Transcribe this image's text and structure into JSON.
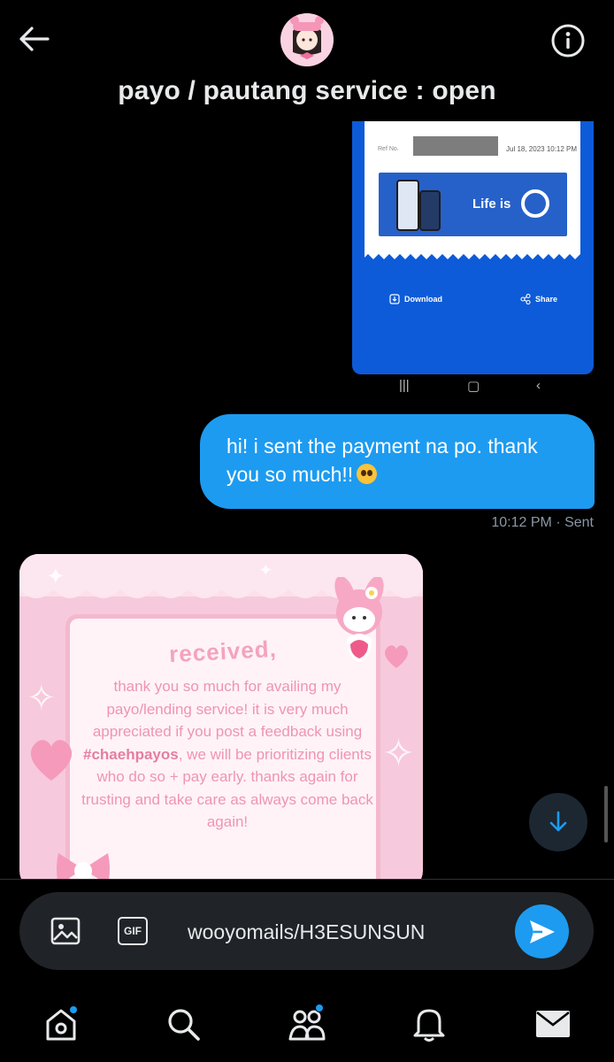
{
  "header": {
    "title": "payo / pautang service : open",
    "back_icon": "arrow-left-icon",
    "info_icon": "info-icon",
    "avatar": "avatar"
  },
  "receipt": {
    "ref_label": "Ref No.",
    "date": "Jul 18, 2023 10:12 PM",
    "banner_text": "Life is",
    "download_label": "Download",
    "share_label": "Share",
    "nav_glyphs": [
      "|||",
      "▢",
      "‹"
    ]
  },
  "sent_message": {
    "text": "hi! i sent the payment na po. thank you so much!!",
    "emoji": "pleading-face-emoji",
    "time": "10:12 PM",
    "status": "· Sent"
  },
  "received_image": {
    "heading": "received,",
    "body_parts": [
      "thank you so much for availing my payo/lending service! it is very much appreciated if you post a feedback using ",
      "#chaehpayos",
      ", we will be prioritizing clients who do so + pay early. thanks again for trusting and take care as always come back again!"
    ]
  },
  "composer": {
    "input_value": "wooyomails/H3ESUNSUN",
    "image_icon": "image-icon",
    "gif_label": "GIF",
    "send_icon": "send-icon"
  },
  "bottom_nav": {
    "items": [
      "home-icon",
      "search-icon",
      "communities-icon",
      "notifications-icon",
      "messages-icon"
    ]
  },
  "colors": {
    "accent": "#1d9bf0",
    "background": "#000000",
    "composer": "#202327",
    "meta_text": "#8b98a5"
  }
}
